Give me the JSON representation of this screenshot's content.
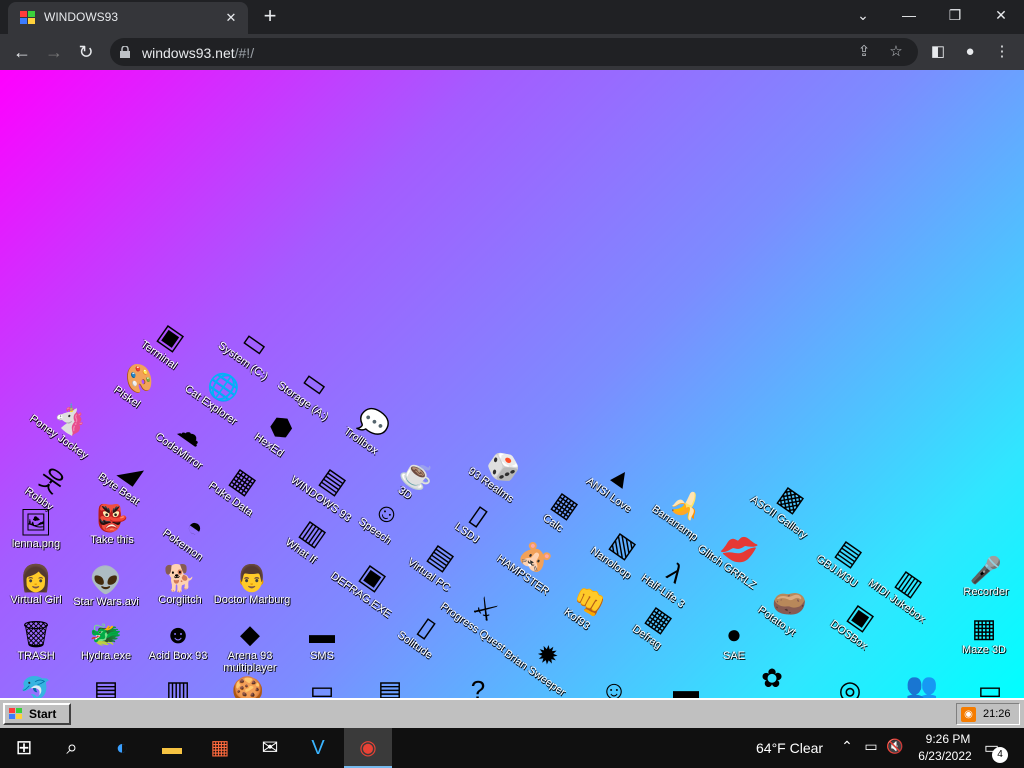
{
  "browser": {
    "tab_title": "WINDOWS93",
    "url_host": "windows93.net",
    "url_path": "/#!/",
    "new_tab_glyph": "+",
    "close_glyph": "✕"
  },
  "desktop_icons": [
    {
      "label": "Terminal",
      "icon": "terminal-icon"
    },
    {
      "label": "System (C:)",
      "icon": "drive-icon"
    },
    {
      "label": "Piskel",
      "icon": "palette-icon"
    },
    {
      "label": "Cat Explorer",
      "icon": "globe-icon"
    },
    {
      "label": "Storage (A:)",
      "icon": "floppy-drive-icon"
    },
    {
      "label": "Poney Jockey",
      "icon": "pony-icon"
    },
    {
      "label": "CodeMirror",
      "icon": "codemirror-icon"
    },
    {
      "label": "HexEd",
      "icon": "hexagon-icon"
    },
    {
      "label": "Trollbox",
      "icon": "chat-bubbles-icon"
    },
    {
      "label": "Robby",
      "icon": "stick-figure-icon"
    },
    {
      "label": "Byte Beat",
      "icon": "wave-icon"
    },
    {
      "label": "Puke Data",
      "icon": "pd-icon"
    },
    {
      "label": "WINDOWS 93",
      "icon": "windows-icon"
    },
    {
      "label": "3D",
      "icon": "teapot-icon"
    },
    {
      "label": "93 Realms",
      "icon": "dice-icon"
    },
    {
      "label": "lenna.png",
      "icon": "image-file-icon"
    },
    {
      "label": "Take this",
      "icon": "character-icon"
    },
    {
      "label": "Pokemon",
      "icon": "pokemon-icon"
    },
    {
      "label": "What If",
      "icon": "window-icon"
    },
    {
      "label": "Speech",
      "icon": "speech-face-icon"
    },
    {
      "label": "LSDJ",
      "icon": "gameboy-icon"
    },
    {
      "label": "Calc",
      "icon": "calculator-icon"
    },
    {
      "label": "ANSI Love",
      "icon": "ansi-icon"
    },
    {
      "label": "Bananamp",
      "icon": "banana-icon"
    },
    {
      "label": "ASCII Gallery",
      "icon": "ascii-icon"
    },
    {
      "label": "Virtual Girl",
      "icon": "face-icon"
    },
    {
      "label": "Star Wars.avi",
      "icon": "yoda-icon"
    },
    {
      "label": "Corgiitch",
      "icon": "corgi-icon"
    },
    {
      "label": "Doctor Marburg",
      "icon": "doctor-icon"
    },
    {
      "label": "DEFRAG.EXE",
      "icon": "defrag-window-icon"
    },
    {
      "label": "Virtual PC",
      "icon": "virtual-pc-icon"
    },
    {
      "label": "HAMPSTER",
      "icon": "hamster-icon"
    },
    {
      "label": "Nanoloop",
      "icon": "nanoloop-icon"
    },
    {
      "label": "Glitch GRRLZ",
      "icon": "lips-icon"
    },
    {
      "label": "GBJ.M3U",
      "icon": "playlist-icon"
    },
    {
      "label": "MIDI Jukebox",
      "icon": "piano-icon"
    },
    {
      "label": "Recorder",
      "icon": "microphone-icon"
    },
    {
      "label": "Progress Quest",
      "icon": "quest-icon"
    },
    {
      "label": "Half-Life 3",
      "icon": "lambda-icon"
    },
    {
      "label": "Potato.yt",
      "icon": "potato-icon"
    },
    {
      "label": "TRASH",
      "icon": "trash-icon"
    },
    {
      "label": "Hydra.exe",
      "icon": "hydra-icon"
    },
    {
      "label": "Acid Box 93",
      "icon": "smiley-icon"
    },
    {
      "label": "Arena 93 multiplayer",
      "icon": "cube-icon"
    },
    {
      "label": "SMS",
      "icon": "sms-icon"
    },
    {
      "label": "Solitude",
      "icon": "solitude-icon"
    },
    {
      "label": "Brian Sweeper",
      "icon": "mine-icon"
    },
    {
      "label": "Kof93",
      "icon": "fighter-icon"
    },
    {
      "label": "Defrag",
      "icon": "defrag-icon"
    },
    {
      "label": "SAE",
      "icon": "amiga-ball-icon"
    },
    {
      "label": "DOSBox",
      "icon": "dosbox-icon"
    },
    {
      "label": "Maze 3D",
      "icon": "maze-icon"
    }
  ],
  "win93_taskbar": {
    "start_label": "Start",
    "clock": "21:26"
  },
  "windows_taskbar": {
    "weather": "64°F  Clear",
    "time": "9:26 PM",
    "date": "6/23/2022",
    "notification_count": "4"
  }
}
